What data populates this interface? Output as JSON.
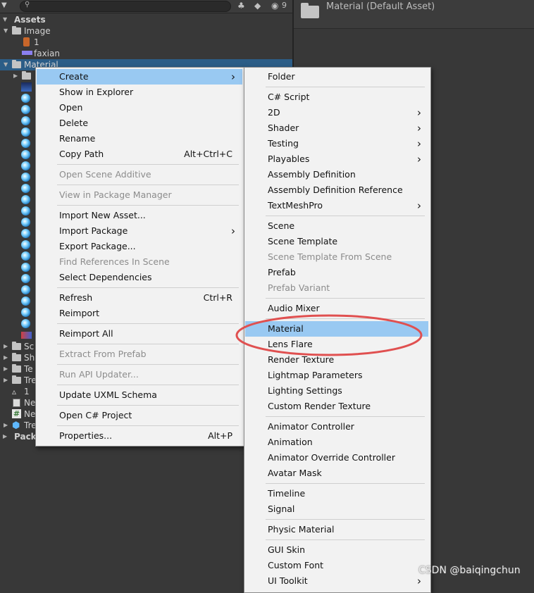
{
  "toolbar": {
    "search_placeholder": "",
    "hidden_count": "9",
    "icons": [
      "dropdown-icon",
      "search-icon",
      "scene-filter-icon",
      "label-filter-icon",
      "visibility-icon"
    ]
  },
  "project": {
    "root_label": "Assets",
    "image_folder": "Image",
    "image_children": [
      "1",
      "faxian"
    ],
    "material_folder": "Material",
    "bottom_items": [
      "Sc",
      "Sh",
      "Te",
      "Tre",
      "1",
      "Ne",
      "Ne",
      "Tre"
    ],
    "packages_label": "Pack"
  },
  "inspector": {
    "title": "Material (Default Asset)"
  },
  "context_menu": {
    "groups": [
      [
        {
          "label": "Create",
          "submenu": true,
          "highlighted": true
        },
        {
          "label": "Show in Explorer"
        },
        {
          "label": "Open"
        },
        {
          "label": "Delete"
        },
        {
          "label": "Rename"
        },
        {
          "label": "Copy Path",
          "shortcut": "Alt+Ctrl+C"
        }
      ],
      [
        {
          "label": "Open Scene Additive",
          "disabled": true
        }
      ],
      [
        {
          "label": "View in Package Manager",
          "disabled": true
        }
      ],
      [
        {
          "label": "Import New Asset..."
        },
        {
          "label": "Import Package",
          "submenu": true
        },
        {
          "label": "Export Package..."
        },
        {
          "label": "Find References In Scene",
          "disabled": true
        },
        {
          "label": "Select Dependencies"
        }
      ],
      [
        {
          "label": "Refresh",
          "shortcut": "Ctrl+R"
        },
        {
          "label": "Reimport"
        }
      ],
      [
        {
          "label": "Reimport All"
        }
      ],
      [
        {
          "label": "Extract From Prefab",
          "disabled": true
        }
      ],
      [
        {
          "label": "Run API Updater...",
          "disabled": true
        }
      ],
      [
        {
          "label": "Update UXML Schema"
        }
      ],
      [
        {
          "label": "Open C# Project"
        }
      ],
      [
        {
          "label": "Properties...",
          "shortcut": "Alt+P"
        }
      ]
    ]
  },
  "create_menu": {
    "groups": [
      [
        {
          "label": "Folder"
        }
      ],
      [
        {
          "label": "C# Script"
        },
        {
          "label": "2D",
          "submenu": true
        },
        {
          "label": "Shader",
          "submenu": true
        },
        {
          "label": "Testing",
          "submenu": true
        },
        {
          "label": "Playables",
          "submenu": true
        },
        {
          "label": "Assembly Definition"
        },
        {
          "label": "Assembly Definition Reference"
        },
        {
          "label": "TextMeshPro",
          "submenu": true
        }
      ],
      [
        {
          "label": "Scene"
        },
        {
          "label": "Scene Template"
        },
        {
          "label": "Scene Template From Scene",
          "disabled": true
        },
        {
          "label": "Prefab"
        },
        {
          "label": "Prefab Variant",
          "disabled": true
        }
      ],
      [
        {
          "label": "Audio Mixer"
        }
      ],
      [
        {
          "label": "Material",
          "highlighted": true
        },
        {
          "label": "Lens Flare"
        },
        {
          "label": "Render Texture"
        },
        {
          "label": "Lightmap Parameters"
        },
        {
          "label": "Lighting Settings"
        },
        {
          "label": "Custom Render Texture"
        }
      ],
      [
        {
          "label": "Animator Controller"
        },
        {
          "label": "Animation"
        },
        {
          "label": "Animator Override Controller"
        },
        {
          "label": "Avatar Mask"
        }
      ],
      [
        {
          "label": "Timeline"
        },
        {
          "label": "Signal"
        }
      ],
      [
        {
          "label": "Physic Material"
        }
      ],
      [
        {
          "label": "GUI Skin"
        },
        {
          "label": "Custom Font"
        },
        {
          "label": "UI Toolkit",
          "submenu": true
        }
      ]
    ]
  },
  "annotation": {
    "color": "#e05050"
  },
  "watermark": "CSDN @baiqingchun"
}
